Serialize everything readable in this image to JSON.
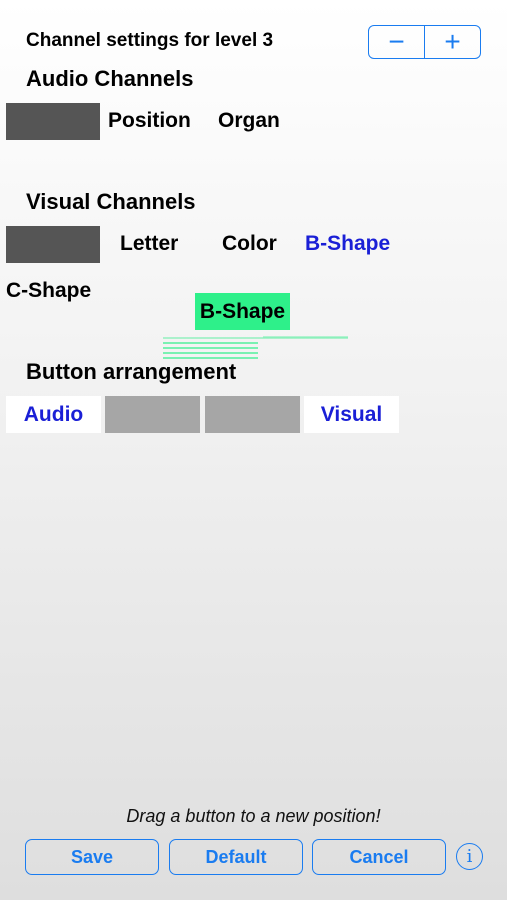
{
  "header": {
    "title": "Channel settings for level 3",
    "stepper": {
      "minus": "−",
      "plus": "+"
    }
  },
  "audio": {
    "heading": "Audio Channels",
    "channels": [
      "Position",
      "Organ"
    ]
  },
  "visual": {
    "heading": "Visual Channels",
    "channels": [
      "Letter",
      "Color",
      "B-Shape",
      "C-Shape"
    ],
    "dragging": "B-Shape"
  },
  "arrangement": {
    "heading": "Button arrangement",
    "cells": [
      "Audio",
      "",
      "",
      "Visual"
    ]
  },
  "footer": {
    "hint": "Drag a button to a new position!",
    "save": "Save",
    "default": "Default",
    "cancel": "Cancel",
    "info_icon": "i"
  },
  "colors": {
    "accent": "#1a7cf0",
    "channel_blue": "#1a1fd6",
    "drag_green": "#2ef08a",
    "slot_dark": "#555555",
    "slot_gray": "#a6a6a6"
  }
}
